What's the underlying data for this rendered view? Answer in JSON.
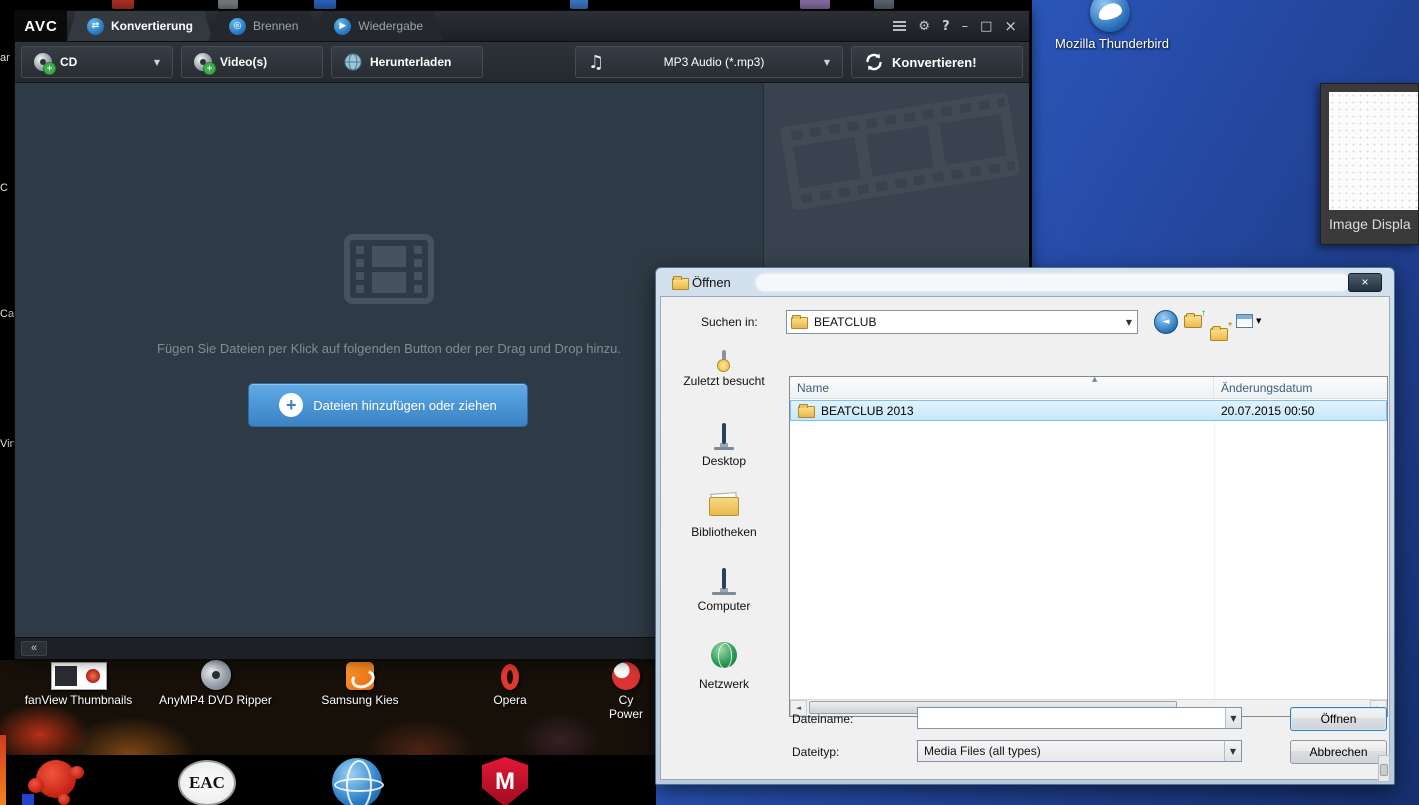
{
  "desktop": {
    "thunderbird_label": "Mozilla Thunderbird",
    "image_window_caption": "Image Displa",
    "edge_labels": [
      "ar",
      "C",
      "Ca",
      "Vin"
    ],
    "icons": [
      {
        "label": "fanView Thumbnails"
      },
      {
        "label": "AnyMP4 DVD Ripper"
      },
      {
        "label": "Samsung Kies"
      },
      {
        "label": "Opera"
      },
      {
        "label": "Cy",
        "label2": "Power"
      }
    ],
    "eac_label": "EAC",
    "mcafee_letter": "M"
  },
  "avc": {
    "logo": "AVC",
    "tabs": [
      {
        "label": "Konvertierung",
        "glyph": "⇄"
      },
      {
        "label": "Brennen",
        "glyph": "◎"
      },
      {
        "label": "Wiedergabe",
        "glyph": "▶"
      }
    ],
    "window_controls": {
      "settings": "⚙",
      "help": "?",
      "minimize": "–",
      "maximize": "□",
      "close": "×"
    },
    "toolbar": {
      "cd_label": "CD",
      "videos_label": "Video(s)",
      "download_label": "Herunterladen",
      "format_value": "MP3 Audio (*.mp3)",
      "convert_label": "Konvertieren!",
      "music_note": "♫",
      "dropdown_arrow": "▼"
    },
    "empty_hint": "Fügen Sie Dateien per Klick auf folgenden Button oder per Drag und Drop hinzu.",
    "add_button_label": "Dateien hinzufügen oder ziehen",
    "add_button_plus": "+",
    "collapse_label": "«"
  },
  "dialog": {
    "title": "Öffnen",
    "close_glyph": "×",
    "look_in_label": "Suchen in:",
    "look_in_value": "BEATCLUB",
    "combo_arrow": "▼",
    "nav": {
      "back_glyph": "◄",
      "up_glyph": "↑",
      "new_glyph": "*",
      "views_arrow": "▼"
    },
    "sidebar": [
      {
        "label": "Zuletzt besucht"
      },
      {
        "label": "Desktop"
      },
      {
        "label": "Bibliotheken"
      },
      {
        "label": "Computer"
      },
      {
        "label": "Netzwerk"
      }
    ],
    "list": {
      "columns": [
        "Name",
        "Änderungsdatum"
      ],
      "sort_glyph": "▲",
      "scroll_left": "◄",
      "scroll_right": "►",
      "rows": [
        {
          "name": "BEATCLUB 2013",
          "date": "20.07.2015 00:50",
          "selected": true
        }
      ]
    },
    "filename_label": "Dateiname:",
    "filename_value": "",
    "filetype_label": "Dateityp:",
    "filetype_value": "Media Files (all types)",
    "open_label": "Öffnen",
    "cancel_label": "Abbrechen"
  }
}
